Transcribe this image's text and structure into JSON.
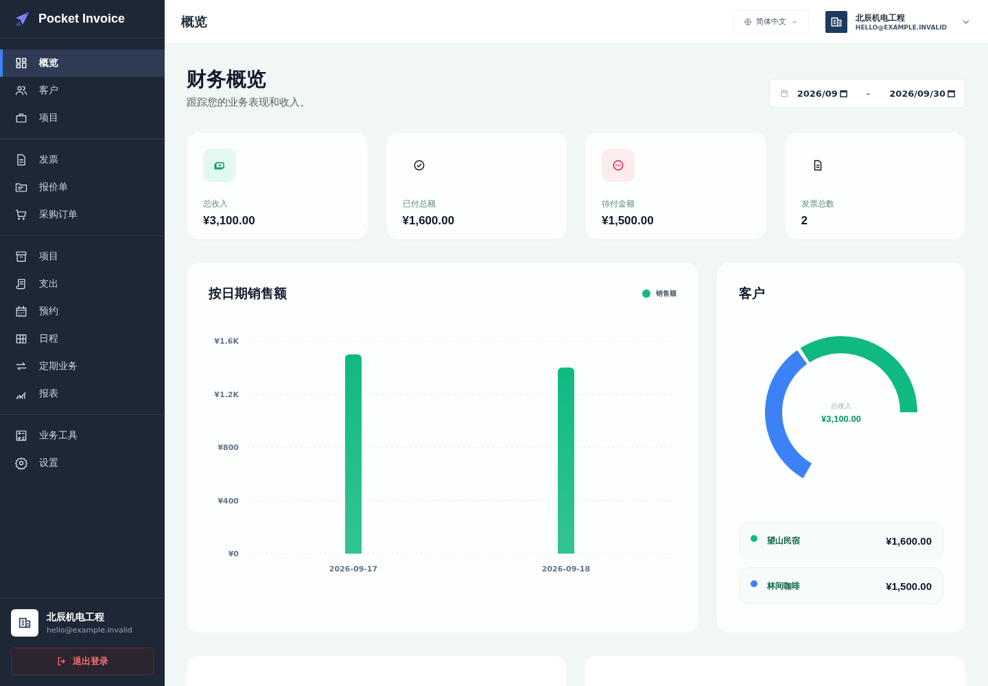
{
  "sidebar": {
    "brand": "Pocket Invoice",
    "groups": [
      [
        {
          "label": "概览",
          "selected": true
        },
        {
          "label": "客户",
          "selected": false
        },
        {
          "label": "项目",
          "selected": false
        }
      ],
      [
        {
          "label": "发票",
          "selected": false
        },
        {
          "label": "报价单",
          "selected": false
        },
        {
          "label": "采购订单",
          "selected": false
        }
      ],
      [
        {
          "label": "项目",
          "selected": false
        },
        {
          "label": "支出",
          "selected": false
        },
        {
          "label": "预约",
          "selected": false
        },
        {
          "label": "日程",
          "selected": false
        },
        {
          "label": "定期业务",
          "selected": false
        },
        {
          "label": "报表",
          "selected": false
        }
      ],
      [
        {
          "label": "业务工具",
          "selected": false
        },
        {
          "label": "设置",
          "selected": false
        }
      ]
    ],
    "account": {
      "name": "北辰机电工程",
      "email": "hello@example.invalid"
    },
    "logout": "退出登录"
  },
  "topbar": {
    "title": "概览",
    "language": "简体中文",
    "account_name": "北辰机电工程",
    "account_email": "HELLO@EXAMPLE.INVALID"
  },
  "header": {
    "title": "财务概览",
    "subtitle": "跟踪您的业务表现和收入。",
    "date_from": "2026/09",
    "date_separator": "-",
    "date_to": "2026/09/30"
  },
  "stats": [
    {
      "label": "总收入",
      "value": "¥3,100.00"
    },
    {
      "label": "已付总额",
      "value": "¥1,600.00"
    },
    {
      "label": "待付金额",
      "value": "¥1,500.00"
    },
    {
      "label": "发票总数",
      "value": "2"
    }
  ],
  "sales_card": {
    "title": "按日期销售额",
    "chart_data": {
      "type": "bar",
      "categories": [
        "2026-09-17",
        "2026-09-18"
      ],
      "series": [
        {
          "name": "销售额",
          "color": "#10b981",
          "values": [
            1500,
            1400
          ]
        }
      ],
      "ylim": [
        0,
        1600
      ],
      "grid": true,
      "yticks": [
        {
          "value": 0,
          "label": "¥0"
        },
        {
          "value": 400,
          "label": "¥400"
        },
        {
          "value": 800,
          "label": "¥800"
        },
        {
          "value": 1200,
          "label": "¥1.2K"
        },
        {
          "value": 1600,
          "label": "¥1.6K"
        }
      ]
    }
  },
  "customers_card": {
    "center_label": "总收入",
    "center_value": "¥3,100.00",
    "chart_data": {
      "type": "donut",
      "categories": [
        "望山民宿",
        "林间咖啡"
      ],
      "series": [
        {
          "name": "客户",
          "values": [
            51.6,
            48.4
          ]
        }
      ]
    },
    "customers": [
      {
        "amount": "¥1,600.00",
        "color": "#10b981"
      },
      {
        "amount": "¥1,500.00",
        "color": "#3b82f6"
      }
    ]
  }
}
